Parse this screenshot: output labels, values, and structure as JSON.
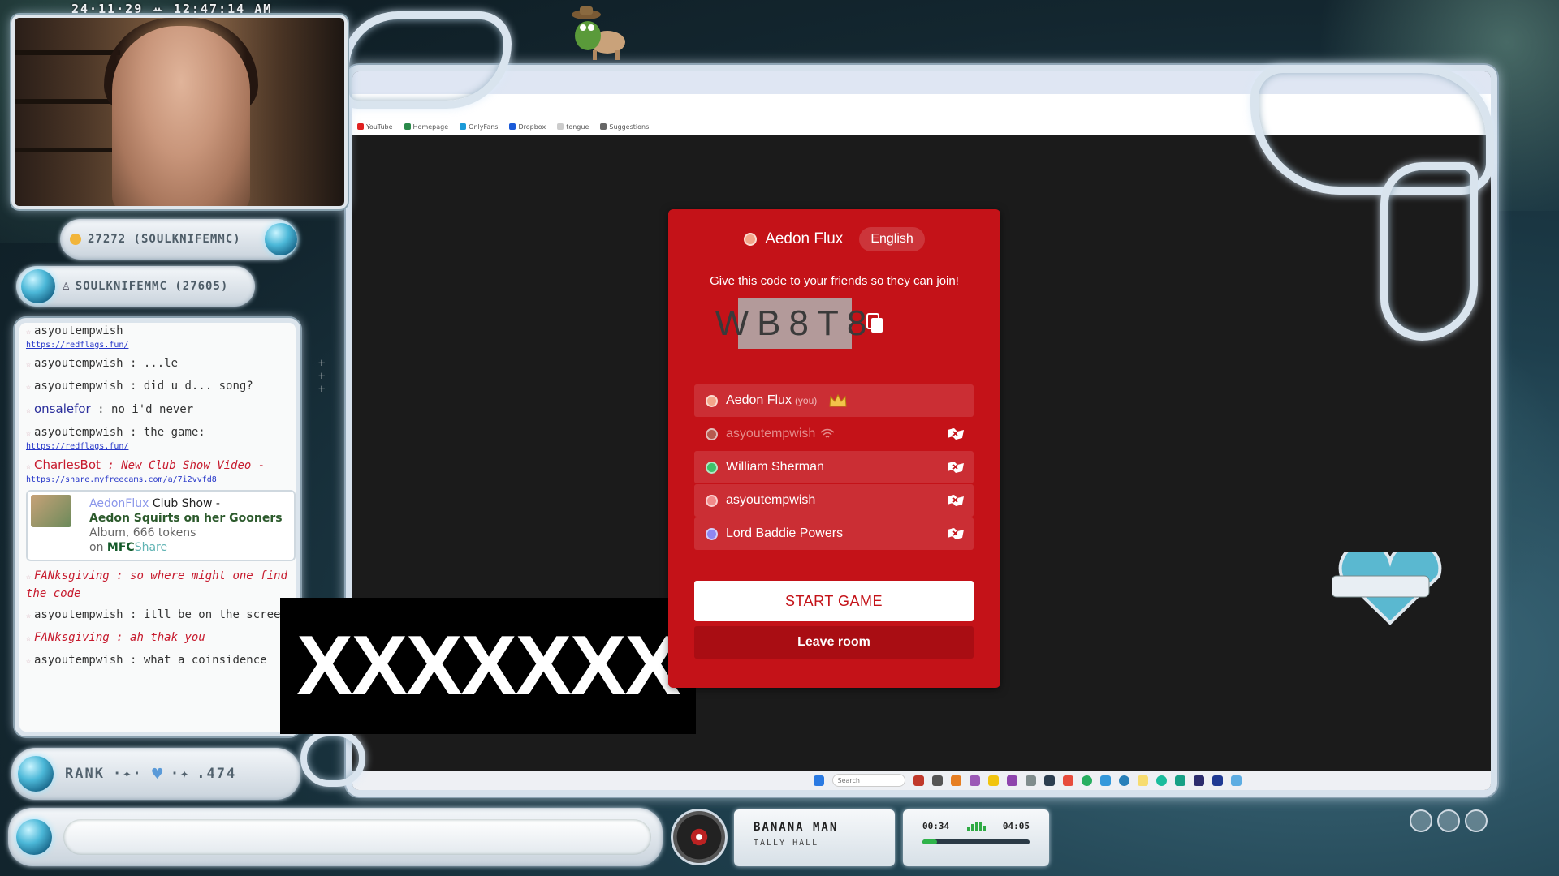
{
  "overlay": {
    "timestamp": "24·11·29 ꕀ 12:47:14 AM",
    "coins": "27272 (SOULKNIFEMMC)",
    "top_user": "SOULKNIFEMMC (27605)",
    "rank_label": "RANK",
    "rank_value": ".474",
    "censor_text": "XXXXXXX"
  },
  "browser": {
    "bookmarks": [
      {
        "label": "YouTube",
        "color": "#e02020"
      },
      {
        "label": "Homepage",
        "color": "#2a8a4a"
      },
      {
        "label": "OnlyFans",
        "color": "#1a9ad8"
      },
      {
        "label": "Dropbox",
        "color": "#1a5ad8"
      },
      {
        "label": "tongue",
        "color": "#cccccc"
      },
      {
        "label": "Suggestions",
        "color": "#666666"
      }
    ],
    "taskbar_search": "Search"
  },
  "chat": {
    "messages": [
      {
        "user": "asyoutempwish",
        "msg": "",
        "link": "https://redflags.fun/"
      },
      {
        "user": "asyoutempwish",
        "msg": ": ...le"
      },
      {
        "user": "asyoutempwish",
        "msg": ": did u d... song?"
      },
      {
        "user": "onsalefor",
        "msg": ": no i'd never"
      },
      {
        "user": "asyoutempwish",
        "msg": ": the game:",
        "link": "https://redflags.fun/"
      },
      {
        "user": "CharlesBot",
        "msg": ": New Club Show Video -",
        "link": "https://share.myfreecams.com/a/7i2vvfd8"
      }
    ],
    "card": {
      "user": "AedonFlux",
      "line1": "Club Show -",
      "title": "Aedon Squirts on her Gooners",
      "detail": "Album, 666 tokens",
      "on": "on",
      "brand": "MFC",
      "brand2": "Share"
    },
    "messages2": [
      {
        "user": "FANksgiving",
        "msg": ": so where might one find the code"
      },
      {
        "user": "asyoutempwish",
        "msg": ": itll be on the screen"
      },
      {
        "user": "FANksgiving",
        "msg": ": ah thak you"
      },
      {
        "user": "asyoutempwish",
        "msg": ": what a coinsidence"
      }
    ]
  },
  "game": {
    "host_name": "Aedon Flux",
    "language": "English",
    "invite_text": "Give this code to your friends so they can join!",
    "room_code": "WB8T8",
    "players": [
      {
        "name": "Aedon Flux",
        "tag": "(you)",
        "color": "#f4a58a",
        "host": true,
        "dim": false
      },
      {
        "name": "asyoutempwish",
        "tag": "",
        "color": "#b75a4e",
        "host": false,
        "dim": true
      },
      {
        "name": "William Sherman",
        "tag": "",
        "color": "#3fc16a",
        "host": false,
        "dim": false
      },
      {
        "name": "asyoutempwish",
        "tag": "",
        "color": "#f28a8a",
        "host": false,
        "dim": false
      },
      {
        "name": "Lord Baddie Powers",
        "tag": "",
        "color": "#8f86f0",
        "host": false,
        "dim": false
      }
    ],
    "start_label": "START GAME",
    "leave_label": "Leave room"
  },
  "now_playing": {
    "title": "BANANA MAN",
    "artist": "TALLY HALL",
    "elapsed": "00:34",
    "total": "04:05",
    "progress": 0.14
  },
  "colors": {
    "modal": "#c41218",
    "accent_green": "#2fb44a"
  }
}
